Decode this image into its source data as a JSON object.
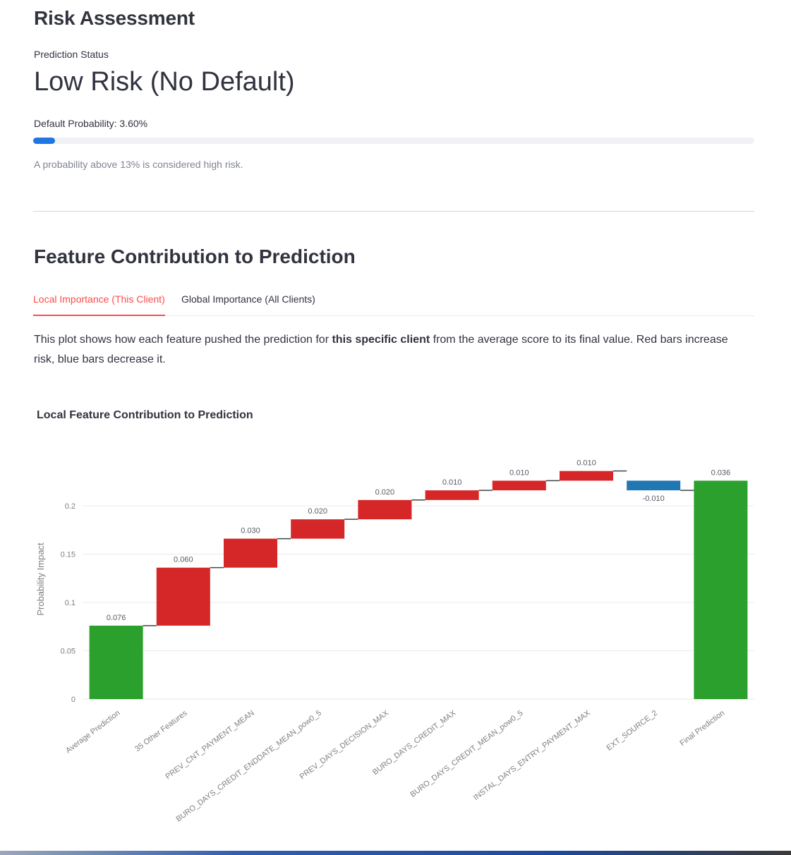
{
  "header": {
    "title": "Risk Assessment"
  },
  "prediction": {
    "status_label": "Prediction Status",
    "status_value": "Low Risk (No Default)",
    "probability_label": "Default Probability: 3.60%",
    "probability_fraction": 0.036,
    "caption": "A probability above 13% is considered high risk."
  },
  "section": {
    "title": "Feature Contribution to Prediction"
  },
  "tabs": [
    {
      "label": "Local Importance (This Client)",
      "active": true
    },
    {
      "label": "Global Importance (All Clients)",
      "active": false
    }
  ],
  "description": {
    "pre": "This plot shows how each feature pushed the prediction for ",
    "bold": "this specific client",
    "post": " from the average score to its final value. Red bars increase risk, blue bars decrease it."
  },
  "colors": {
    "total": "#2ca02c",
    "increase": "#d62728",
    "decrease": "#1f77b4",
    "accent": "#ff4b4b",
    "progress": "#1f77e4"
  },
  "chart_data": {
    "type": "bar",
    "subtype": "waterfall",
    "title": "Local Feature Contribution to Prediction",
    "xlabel": "",
    "ylabel": "Probability Impact",
    "ylim": [
      0,
      0.235
    ],
    "yticks": [
      0,
      0.05,
      0.1,
      0.15,
      0.2
    ],
    "ytick_labels": [
      "0",
      "0.05",
      "0.1",
      "0.15",
      "0.2"
    ],
    "grid": true,
    "categories": [
      "Average Prediction",
      "35 Other Features",
      "PREV_CNT_PAYMENT_MEAN",
      "BURO_DAYS_CREDIT_ENDDATE_MEAN_pow0_5",
      "PREV_DAYS_DECISION_MAX",
      "BURO_DAYS_CREDIT_MAX",
      "BURO_DAYS_CREDIT_MEAN_pow0_5",
      "INSTAL_DAYS_ENTRY_PAYMENT_MAX",
      "EXT_SOURCE_2",
      "Final Prediction"
    ],
    "kinds": [
      "total",
      "increase",
      "increase",
      "increase",
      "increase",
      "increase",
      "increase",
      "increase",
      "decrease",
      "total"
    ],
    "bases": [
      0,
      0.076,
      0.136,
      0.166,
      0.186,
      0.206,
      0.216,
      0.226,
      0.226,
      0
    ],
    "values": [
      0.076,
      0.06,
      0.03,
      0.02,
      0.02,
      0.01,
      0.01,
      0.01,
      -0.01,
      0.226
    ],
    "labels": [
      "0.076",
      "0.060",
      "0.030",
      "0.020",
      "0.020",
      "0.010",
      "0.010",
      "0.010",
      "-0.010",
      "0.036"
    ]
  }
}
